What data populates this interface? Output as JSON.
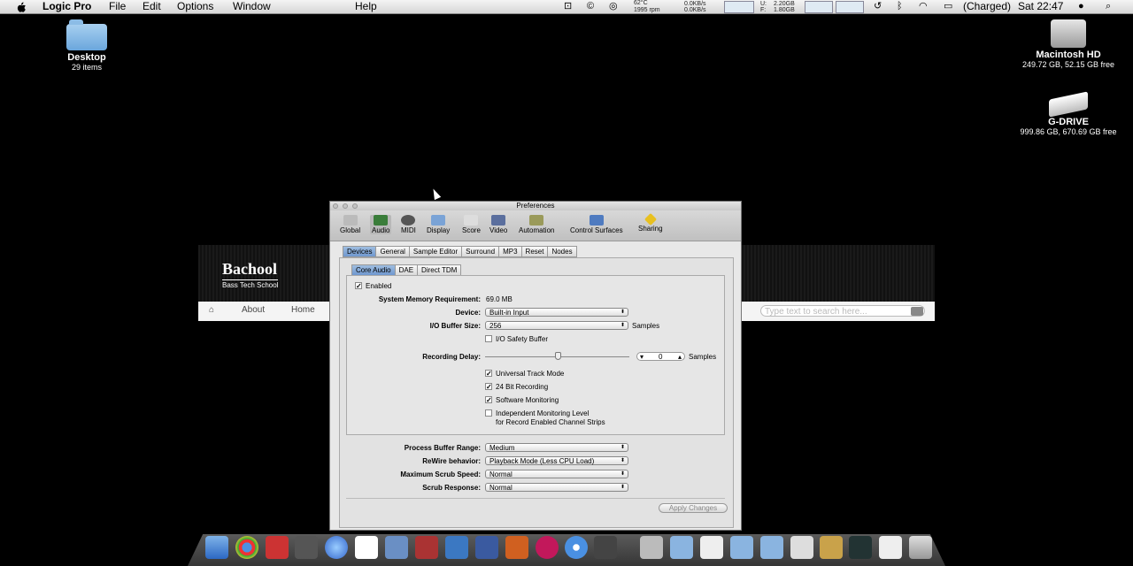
{
  "menubar": {
    "app_name": "Logic Pro",
    "menus": [
      "File",
      "Edit",
      "Options",
      "Window",
      "Help"
    ],
    "temp": "62°C",
    "rpm": "1995 rpm",
    "net_up": "0.0KB/s",
    "net_down": "0.0KB/s",
    "mem_u_label": "U:",
    "mem_u": "2.20GB",
    "mem_f_label": "F:",
    "mem_f": "1.80GB",
    "battery": "(Charged)",
    "clock": "Sat 22:47"
  },
  "desktop": {
    "left_icon": {
      "label": "Desktop",
      "sub": "29 items"
    },
    "right_icons": [
      {
        "label": "Macintosh HD",
        "sub": "249.72 GB, 52.15 GB free"
      },
      {
        "label": "G-DRIVE",
        "sub": "999.86 GB, 670.69 GB free"
      }
    ]
  },
  "website": {
    "brand": "Bachool",
    "tagline": "Bass Tech School",
    "nav": [
      "About",
      "Home"
    ],
    "search_placeholder": "Type text to search here..."
  },
  "prefs": {
    "title": "Preferences",
    "toolbar": [
      "Global",
      "Audio",
      "MIDI",
      "Display",
      "Score",
      "Video",
      "Automation",
      "Control Surfaces",
      "Sharing"
    ],
    "selected_toolbar": "Audio",
    "tabs": [
      "Devices",
      "General",
      "Sample Editor",
      "Surround",
      "MP3",
      "Reset",
      "Nodes"
    ],
    "selected_tab": "Devices",
    "subtabs": [
      "Core Audio",
      "DAE",
      "Direct TDM"
    ],
    "selected_subtab": "Core Audio",
    "enabled_label": "Enabled",
    "enabled": true,
    "memory_label": "System Memory Requirement:",
    "memory_value": "69.0 MB",
    "device_label": "Device:",
    "device_value": "Built-in Input",
    "buffer_label": "I/O Buffer Size:",
    "buffer_value": "256",
    "buffer_unit": "Samples",
    "safety_label": "I/O Safety Buffer",
    "safety": false,
    "delay_label": "Recording Delay:",
    "delay_value": "0",
    "delay_unit": "Samples",
    "delay_slider_fraction": 0.5,
    "checks": [
      {
        "label": "Universal Track Mode",
        "checked": true
      },
      {
        "label": "24 Bit Recording",
        "checked": true
      },
      {
        "label": "Software Monitoring",
        "checked": true
      },
      {
        "label": "Independent Monitoring Level",
        "checked": false
      }
    ],
    "independent_sub": "for Record Enabled Channel Strips",
    "process_label": "Process Buffer Range:",
    "process_value": "Medium",
    "rewire_label": "ReWire behavior:",
    "rewire_value": "Playback Mode (Less CPU Load)",
    "scrub_speed_label": "Maximum Scrub Speed:",
    "scrub_speed_value": "Normal",
    "scrub_resp_label": "Scrub Response:",
    "scrub_resp_value": "Normal",
    "apply_label": "Apply Changes"
  }
}
